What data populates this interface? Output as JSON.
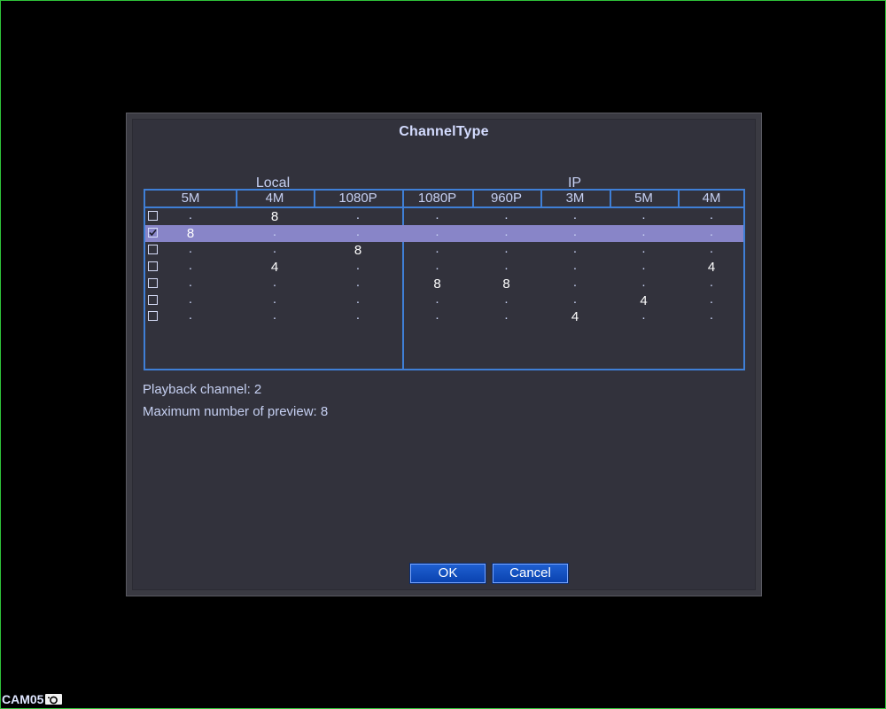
{
  "dialog": {
    "title": "ChannelType",
    "groups": {
      "local": "Local",
      "ip": "IP"
    },
    "columns": [
      "5M",
      "4M",
      "1080P",
      "1080P",
      "960P",
      "3M",
      "5M",
      "4M"
    ],
    "rows": [
      {
        "checked": false,
        "selected": false,
        "values": [
          ".",
          "8",
          ".",
          ".",
          ".",
          ".",
          ".",
          "."
        ]
      },
      {
        "checked": true,
        "selected": true,
        "values": [
          "8",
          ".",
          ".",
          ".",
          ".",
          ".",
          ".",
          "."
        ]
      },
      {
        "checked": false,
        "selected": false,
        "values": [
          ".",
          ".",
          "8",
          ".",
          ".",
          ".",
          ".",
          "."
        ]
      },
      {
        "checked": false,
        "selected": false,
        "values": [
          ".",
          "4",
          ".",
          ".",
          ".",
          ".",
          ".",
          "4"
        ]
      },
      {
        "checked": false,
        "selected": false,
        "values": [
          ".",
          ".",
          ".",
          "8",
          "8",
          ".",
          ".",
          "."
        ]
      },
      {
        "checked": false,
        "selected": false,
        "values": [
          ".",
          ".",
          ".",
          ".",
          ".",
          ".",
          "4",
          "."
        ]
      },
      {
        "checked": false,
        "selected": false,
        "values": [
          ".",
          ".",
          ".",
          ".",
          ".",
          "4",
          ".",
          "."
        ]
      }
    ],
    "playback_channel": "Playback channel: 2",
    "max_preview": "Maximum number of preview: 8",
    "ok_label": "OK",
    "cancel_label": "Cancel"
  },
  "camera": {
    "name": "CAM05",
    "icon": "camera-icon"
  },
  "colors": {
    "grid_border": "#3f7fd6",
    "selected_row": "#8885c8",
    "button": "#1f5fd0",
    "screen_border": "#2fc23a"
  }
}
